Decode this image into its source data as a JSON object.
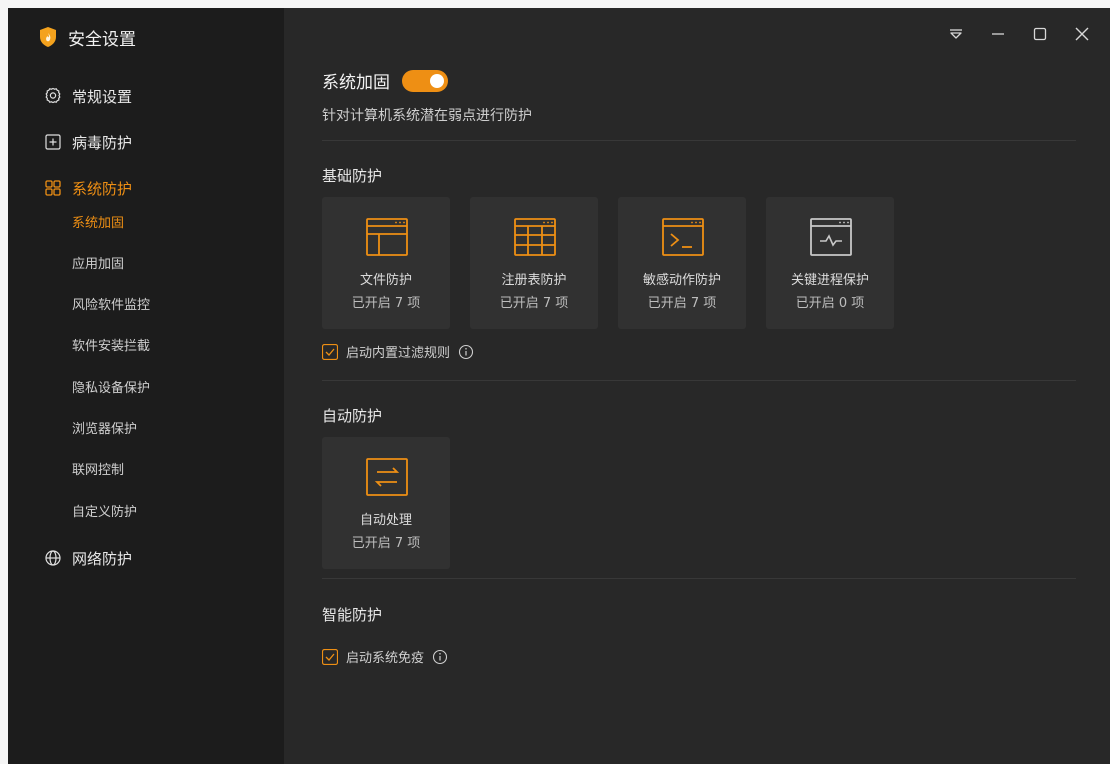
{
  "app": {
    "title": "安全设置",
    "accent_color": "#ee8f14"
  },
  "sidebar": {
    "items": [
      {
        "label": "常规设置",
        "icon": "gear-icon"
      },
      {
        "label": "病毒防护",
        "icon": "plus-square-icon"
      },
      {
        "label": "系统防护",
        "icon": "grid-icon",
        "active": true
      },
      {
        "label": "网络防护",
        "icon": "globe-icon"
      }
    ],
    "sub_items": [
      {
        "label": "系统加固",
        "active": true
      },
      {
        "label": "应用加固"
      },
      {
        "label": "风险软件监控"
      },
      {
        "label": "软件安装拦截"
      },
      {
        "label": "隐私设备保护"
      },
      {
        "label": "浏览器保护"
      },
      {
        "label": "联网控制"
      },
      {
        "label": "自定义防护"
      }
    ]
  },
  "window_controls": [
    "dropdown-icon",
    "minimize-icon",
    "maximize-icon",
    "close-icon"
  ],
  "main": {
    "title": "系统加固",
    "toggle_on": true,
    "description": "针对计算机系统潜在弱点进行防护",
    "sections": {
      "basic": {
        "title": "基础防护",
        "cards": [
          {
            "name": "文件防护",
            "status": "已开启 7 项",
            "icon": "file-window-icon"
          },
          {
            "name": "注册表防护",
            "status": "已开启 7 项",
            "icon": "registry-table-icon"
          },
          {
            "name": "敏感动作防护",
            "status": "已开启 7 项",
            "icon": "terminal-icon"
          },
          {
            "name": "关键进程保护",
            "status": "已开启 0 项",
            "icon": "pulse-window-icon"
          }
        ],
        "checkbox": {
          "label": "启动内置过滤规则",
          "checked": true
        }
      },
      "auto": {
        "title": "自动防护",
        "cards": [
          {
            "name": "自动处理",
            "status": "已开启 7 项",
            "icon": "swap-arrows-icon"
          }
        ]
      },
      "smart": {
        "title": "智能防护",
        "checkbox": {
          "label": "启动系统免疫",
          "checked": true
        }
      }
    }
  }
}
